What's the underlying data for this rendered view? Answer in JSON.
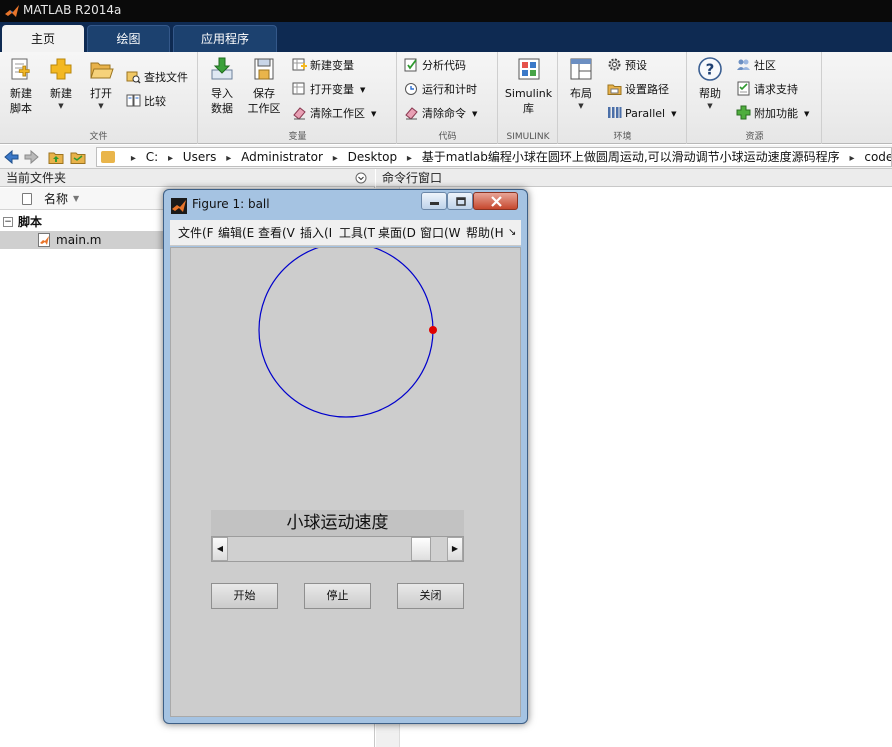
{
  "app": {
    "title": "MATLAB R2014a"
  },
  "tabs": [
    {
      "label": "主页",
      "active": true
    },
    {
      "label": "绘图",
      "active": false
    },
    {
      "label": "应用程序",
      "active": false
    }
  ],
  "ribbon": {
    "groups": {
      "file": "文件",
      "variable": "变量",
      "code": "代码",
      "simulink": "SIMULINK",
      "environment": "环境",
      "resources": "资源"
    },
    "new_script": [
      "新建",
      "脚本"
    ],
    "new": "新建",
    "open": "打开",
    "find_files": "查找文件",
    "compare": "比较",
    "import_data": [
      "导入",
      "数据"
    ],
    "save_workspace": [
      "保存",
      "工作区"
    ],
    "new_variable": "新建变量",
    "open_variable": "打开变量",
    "clear_workspace": "清除工作区",
    "analyze_code": "分析代码",
    "run_and_time": "运行和计时",
    "clear_commands": "清除命令",
    "simulink_library": [
      "Simulink",
      "库"
    ],
    "layout": "布局",
    "preferences": "预设",
    "set_path": "设置路径",
    "parallel": "Parallel",
    "help": "帮助",
    "community": "社区",
    "request_support": "请求支持",
    "addons": "附加功能"
  },
  "address": {
    "segments": [
      "C:",
      "Users",
      "Administrator",
      "Desktop",
      "基于matlab编程小球在圆环上做圆周运动,可以滑动调节小球运动速度源码程序",
      "code"
    ]
  },
  "left_panel": {
    "title": "当前文件夹",
    "column_name": "名称",
    "group_label": "脚本",
    "files": [
      {
        "name": "main.m"
      }
    ]
  },
  "right_panel": {
    "title": "命令行窗口"
  },
  "figure": {
    "title": "Figure 1: ball",
    "menu": [
      "文件(F",
      "编辑(E",
      "查看(V",
      "插入(I",
      "工具(T",
      "桌面(D",
      "窗口(W",
      "帮助(H"
    ],
    "speed_label": "小球运动速度",
    "slider_value": 0.92,
    "buttons": {
      "start": "开始",
      "stop": "停止",
      "close": "关闭"
    },
    "circle_color": "#0000cc",
    "ball_color": "#e00000"
  }
}
